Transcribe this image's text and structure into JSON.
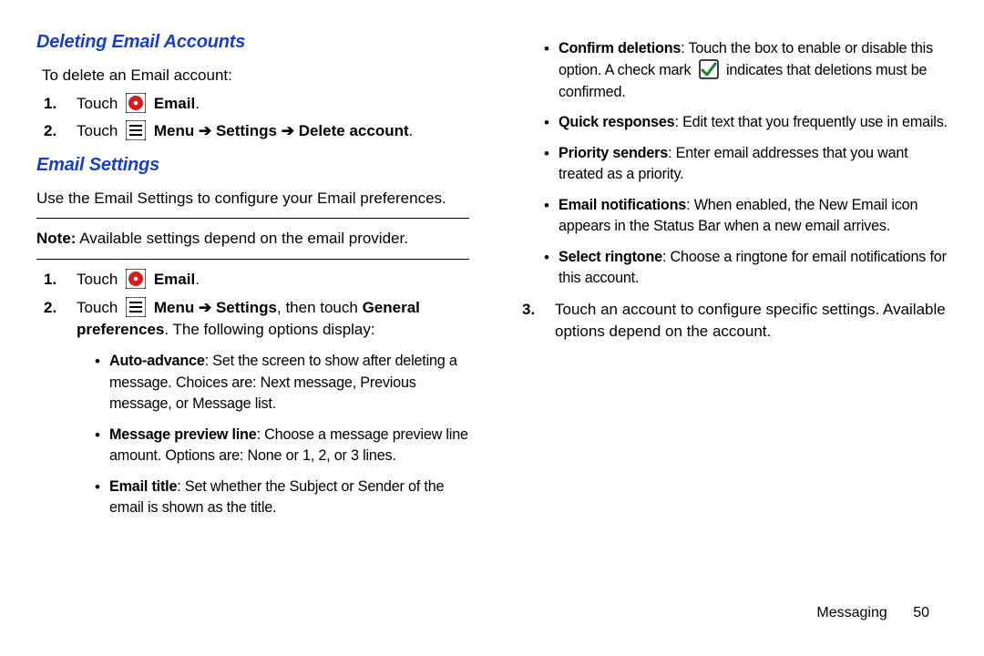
{
  "heading_deleting": "Deleting Email Accounts",
  "intro_deleting": "To delete an Email account:",
  "step_touch": "Touch",
  "email_bold": "Email",
  "period": ".",
  "menu_bold": "Menu",
  "arrow": " ➔ ",
  "settings_bold": "Settings",
  "delete_account_bold": "Delete account",
  "heading_emailsettings": "Email Settings",
  "intro_settings": "Use the Email Settings to configure your Email preferences.",
  "note_bold": "Note:",
  "note_text": " Available settings depend on the email provider.",
  "comma_then_touch": ", then touch ",
  "general_preferences_bold": "General preferences",
  "following_options": ". The following options display:",
  "bullets_left": {
    "auto_advance": {
      "title": "Auto-advance",
      "text": ": Set the screen to show after deleting a message. Choices are: Next message, Previous message, or Message list."
    },
    "msg_preview": {
      "title": "Message preview line",
      "text": ": Choose a message preview line amount. Options are: None or 1, 2, or 3 lines."
    },
    "email_title": {
      "title": "Email title",
      "text": ": Set whether the Subject or Sender of the email is shown as the title."
    }
  },
  "bullets_right": {
    "confirm": {
      "title": "Confirm deletions",
      "text_before_icon": ": Touch the box to enable or disable this option. A check mark ",
      "text_after_icon": " indicates that deletions must be confirmed."
    },
    "quick": {
      "title": "Quick responses",
      "text": ": Edit text that you frequently use in emails."
    },
    "priority": {
      "title": "Priority senders",
      "text": ": Enter email addresses that you want treated as a priority."
    },
    "notif": {
      "title": "Email notifications",
      "text": ": When enabled, the New Email icon appears in the Status Bar when a new email arrives."
    },
    "ringtone": {
      "title": "Select ringtone",
      "text": ": Choose a ringtone for email notifications for this account."
    }
  },
  "step3_text": "Touch an account to configure specific settings. Available options depend on the account.",
  "footer_label": "Messaging",
  "footer_page": "50"
}
